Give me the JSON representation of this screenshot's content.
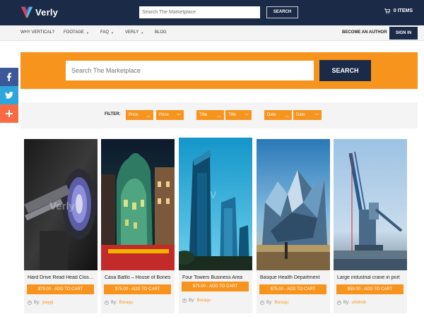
{
  "header": {
    "logo_text": "Verly",
    "search_placeholder": "Search The Marketplace",
    "search_button": "SEARCH",
    "cart_label": "0 ITEMS"
  },
  "nav": {
    "items": [
      {
        "label": "WHY VERTICAL?",
        "caret": false
      },
      {
        "label": "FOOTAGE",
        "caret": true
      },
      {
        "label": "FAQ",
        "caret": true
      },
      {
        "label": "VERLY",
        "caret": true
      },
      {
        "label": "BLOG",
        "caret": false
      }
    ],
    "become_author": "BECOME AN AUTHOR",
    "sign_in": "SIGN IN"
  },
  "hero": {
    "search_placeholder": "Search The Marketplace",
    "search_button": "SEARCH"
  },
  "filter": {
    "label": "FILTER:",
    "pills": [
      {
        "label": "Price",
        "chevron": "up"
      },
      {
        "label": "Price",
        "chevron": "down"
      },
      {
        "label": "Title",
        "chevron": "up"
      },
      {
        "label": "Title",
        "chevron": "down"
      },
      {
        "label": "Date",
        "chevron": "up"
      },
      {
        "label": "Date",
        "chevron": "down"
      }
    ]
  },
  "products": [
    {
      "title": "Hard Drive Read Head Close Up",
      "button": "$79.00 - ADD TO CART",
      "by": "By:",
      "author": "joeygi"
    },
    {
      "title": "Casa Batllo – House of Bones",
      "button": "$75.00 - ADD TO CART",
      "by": "By:",
      "author": "Boraqu"
    },
    {
      "title": "Four Towers Business Area",
      "button": "$75.00 - ADD TO CART",
      "by": "By:",
      "author": "Boraqu"
    },
    {
      "title": "Basque Health Department",
      "button": "$75.00 - ADD TO CART",
      "by": "By:",
      "author": "Boraqu"
    },
    {
      "title": "Large industrial crane in port",
      "button": "$59.00 - ADD TO CART",
      "by": "By:",
      "author": "orbitrob"
    }
  ],
  "colors": {
    "navy": "#1b2a47",
    "orange": "#f7941d",
    "facebook": "#3b5998",
    "twitter": "#2ea6dc",
    "share_plus": "#fb6a44"
  },
  "icons": [
    "logo-v-icon",
    "cart-icon",
    "facebook-icon",
    "twitter-icon",
    "plus-icon",
    "chevron-up-icon",
    "chevron-down-icon",
    "user-icon"
  ]
}
